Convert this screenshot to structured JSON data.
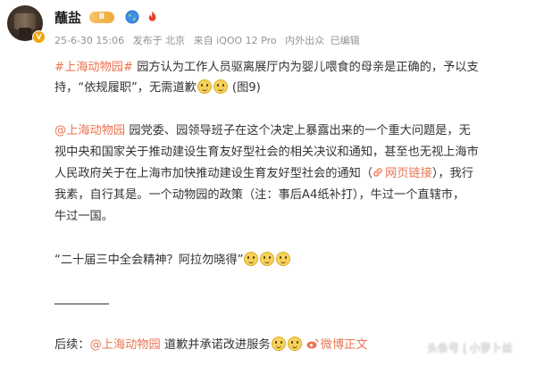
{
  "post": {
    "author": "蘸盐",
    "level_badge": "Ⅱ",
    "meta": {
      "date": "25-6-30 15:06",
      "posted_from": "发布于 北京",
      "device": "来自 iQOO 12 Pro",
      "visibility": "内外出众",
      "edited": "已编辑"
    },
    "p1": {
      "hashtag": "#上海动物园#",
      "text_a": " 园方认为工作人员驱离展厅内为婴儿喂食的母亲是正确的，予以支",
      "text_b": "持，“依规履职”，无需道歉",
      "suffix": " (图9)"
    },
    "p2": {
      "mention": "@上海动物园",
      "line1": " 园党委、园领导班子在这个决定上暴露出来的一个重大问题是，无",
      "line2": "视中央和国家关于推动建设生育友好型社会的相关决议和通知，甚至也无视上海市",
      "line3_a": "人民政府关于在上海市加快推动建设生育友好型社会的通知（",
      "web_link": "网页链接",
      "line3_b": "），我行",
      "line4": "我素，自行其是。一个动物园的政策（注：事后A4纸补打），牛过一个直辖市，",
      "line5": "牛过一国。"
    },
    "p3": "“二十届三中全会精神？阿拉勿晓得”",
    "footer": {
      "prefix": "后续：",
      "mention": "@上海动物园",
      "text": " 道歉并承诺改进服务",
      "weibo_link": "微博正文"
    },
    "watermark": "头条号 | 小萝卜丝"
  },
  "colors": {
    "link": "#eb7350",
    "text": "#333333",
    "meta": "#939393"
  },
  "icons": [
    "avatar",
    "verified-badge-icon",
    "level-badge",
    "globe-icon",
    "fire-icon",
    "smile-emoji-icon",
    "link-icon",
    "weibo-icon"
  ]
}
